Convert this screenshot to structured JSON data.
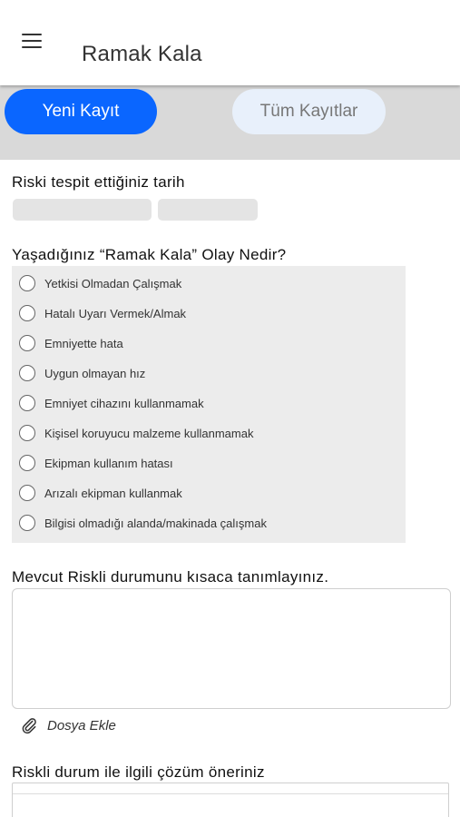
{
  "header": {
    "title": "Ramak Kala",
    "menu_icon": "menu-icon"
  },
  "tabs": {
    "new_record": "Yeni Kayıt",
    "all_records": "Tüm Kayıtlar"
  },
  "colors": {
    "accent": "#0a66ff",
    "tab_inactive_bg": "#e8f0fb",
    "tabbar_bg": "#d9d9d9",
    "field_bg": "#e4e4e4"
  },
  "form": {
    "date_label": "Riski tespit ettiğiniz tarih",
    "event_label": "Yaşadığınız “Ramak Kala” Olay Nedir?",
    "event_options": [
      "Yetkisi Olmadan Çalışmak",
      "Hatalı Uyarı Vermek/Almak",
      "Emniyette hata",
      "Uygun olmayan hız",
      "Emniyet cihazını kullanmamak",
      "Kişisel koruyucu malzeme kullanmamak",
      "Ekipman kullanım hatası",
      "Arızalı ekipman kullanmak",
      "Bilgisi olmadığı alanda/makinada çalışmak"
    ],
    "description_label": "Mevcut Riskli durumunu kısaca tanımlayınız.",
    "attach_label": "Dosya Ekle",
    "attach_icon": "paperclip-icon",
    "solution_label": "Riskli durum ile ilgili çözüm öneriniz"
  }
}
